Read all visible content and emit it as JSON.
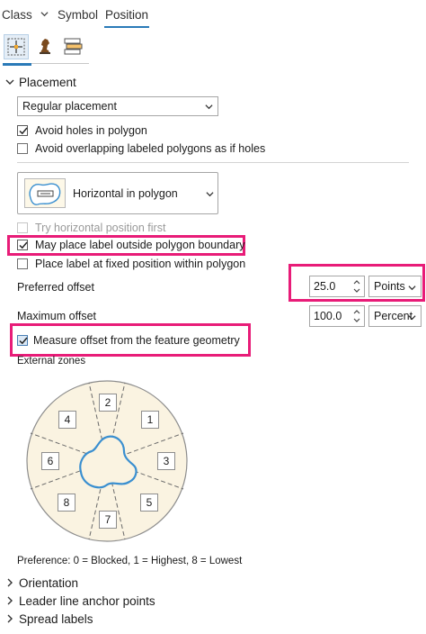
{
  "tabs": [
    {
      "label": "Class",
      "has_dropdown": true
    },
    {
      "label": "Symbol"
    },
    {
      "label": "Position",
      "active": true
    }
  ],
  "subtabs": [
    {
      "icon": "position-crosshair-icon",
      "active": true
    },
    {
      "icon": "conflict-resolution-icon"
    },
    {
      "icon": "label-stacking-icon"
    }
  ],
  "placement": {
    "header": "Placement",
    "select_value": "Regular placement",
    "avoid_holes": {
      "label": "Avoid holes in polygon",
      "checked": true
    },
    "avoid_overlap": {
      "label": "Avoid overlapping labeled polygons as if holes",
      "checked": false
    },
    "style_select": "Horizontal in polygon",
    "try_horizontal": {
      "label": "Try horizontal position first",
      "checked": false,
      "disabled": true
    },
    "may_place_outside": {
      "label": "May place label outside polygon boundary",
      "checked": true
    },
    "fixed_position": {
      "label": "Place label at fixed position within polygon",
      "checked": false
    },
    "preferred_offset": {
      "label": "Preferred offset",
      "value": "25.0",
      "unit": "Points"
    },
    "maximum_offset": {
      "label": "Maximum offset",
      "value": "100.0",
      "unit": "Percent"
    },
    "measure_from_geometry": {
      "label": "Measure offset from the feature geometry",
      "checked": true
    },
    "external_zones_label": "External zones",
    "zones": [
      "2",
      "1",
      "3",
      "5",
      "7",
      "8",
      "6",
      "4"
    ],
    "preference_note": "Preference: 0 = Blocked, 1 = Highest, 8 = Lowest"
  },
  "collapsed_sections": [
    "Orientation",
    "Leader line anchor points",
    "Spread labels"
  ],
  "colors": {
    "accent": "#2a7ab8",
    "highlight": "#e81c78",
    "zone_fill": "#faf3e1",
    "polygon_stroke": "#3a8fd0"
  }
}
